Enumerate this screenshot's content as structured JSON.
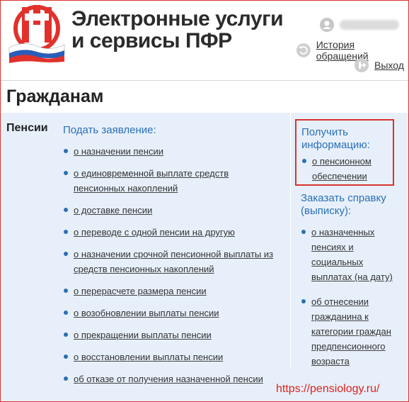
{
  "header": {
    "site_title_line1": "Электронные услуги",
    "site_title_line2": "и сервисы ПФР",
    "history_link": "История обращений",
    "logout_link": "Выход"
  },
  "section": {
    "title": "Гражданам"
  },
  "category": {
    "name": "Пенсии"
  },
  "apply": {
    "heading": "Подать заявление:",
    "items": [
      "о назначении пенсии",
      "о единовременной выплате средств пенсионных накоплений",
      "о доставке пенсии",
      "о переводе с одной пенсии на другую",
      "о назначении срочной пенсионной выплаты из средств пенсионных накоплений",
      "о перерасчете размера пенсии",
      "о возобновлении выплаты пенсии",
      "о прекращении выплаты пенсии",
      "о восстановлении выплаты пенсии",
      "об отказе от получения назначенной пенсии"
    ]
  },
  "info": {
    "heading": "Получить информацию:",
    "items": [
      "о пенсионном обеспечении"
    ]
  },
  "order": {
    "heading": "Заказать справку (выписку):",
    "items": [
      "о назначенных пенсиях и социальных выплатах (на дату)",
      "об отнесении гражданина к категории граждан предпенсионного возраста"
    ]
  },
  "watermark": "https://pensiology.ru/",
  "colors": {
    "accent": "#d8342f",
    "link_blue": "#2a6fb7",
    "panel_bg": "#e7f0fa"
  }
}
